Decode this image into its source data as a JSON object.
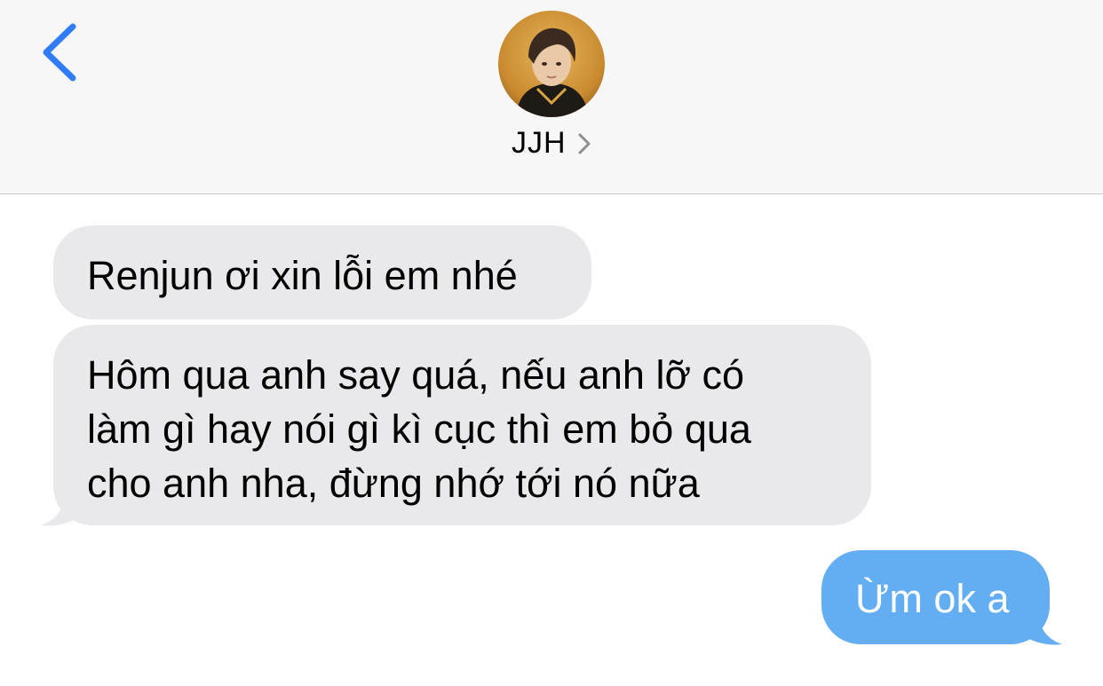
{
  "header": {
    "contact_name": "JJH"
  },
  "icons": {
    "back": "chevron-left-icon",
    "contact_details": "chevron-right-icon",
    "avatar": "contact-avatar-photo"
  },
  "colors": {
    "accent": "#2f7cf6",
    "incoming_bubble": "#e9e9eb",
    "outgoing_bubble": "#63aef3",
    "header_bg": "#f7f7f7"
  },
  "messages": [
    {
      "direction": "incoming",
      "text": "Renjun ơi xin lỗi em nhé"
    },
    {
      "direction": "incoming",
      "lines": [
        "Hôm qua anh say quá, nếu anh lỡ có",
        "làm gì hay nói gì kì cục thì em bỏ qua",
        "cho anh nha, đừng nhớ tới nó nữa"
      ]
    },
    {
      "direction": "outgoing",
      "text": "Ừm ok a"
    }
  ]
}
